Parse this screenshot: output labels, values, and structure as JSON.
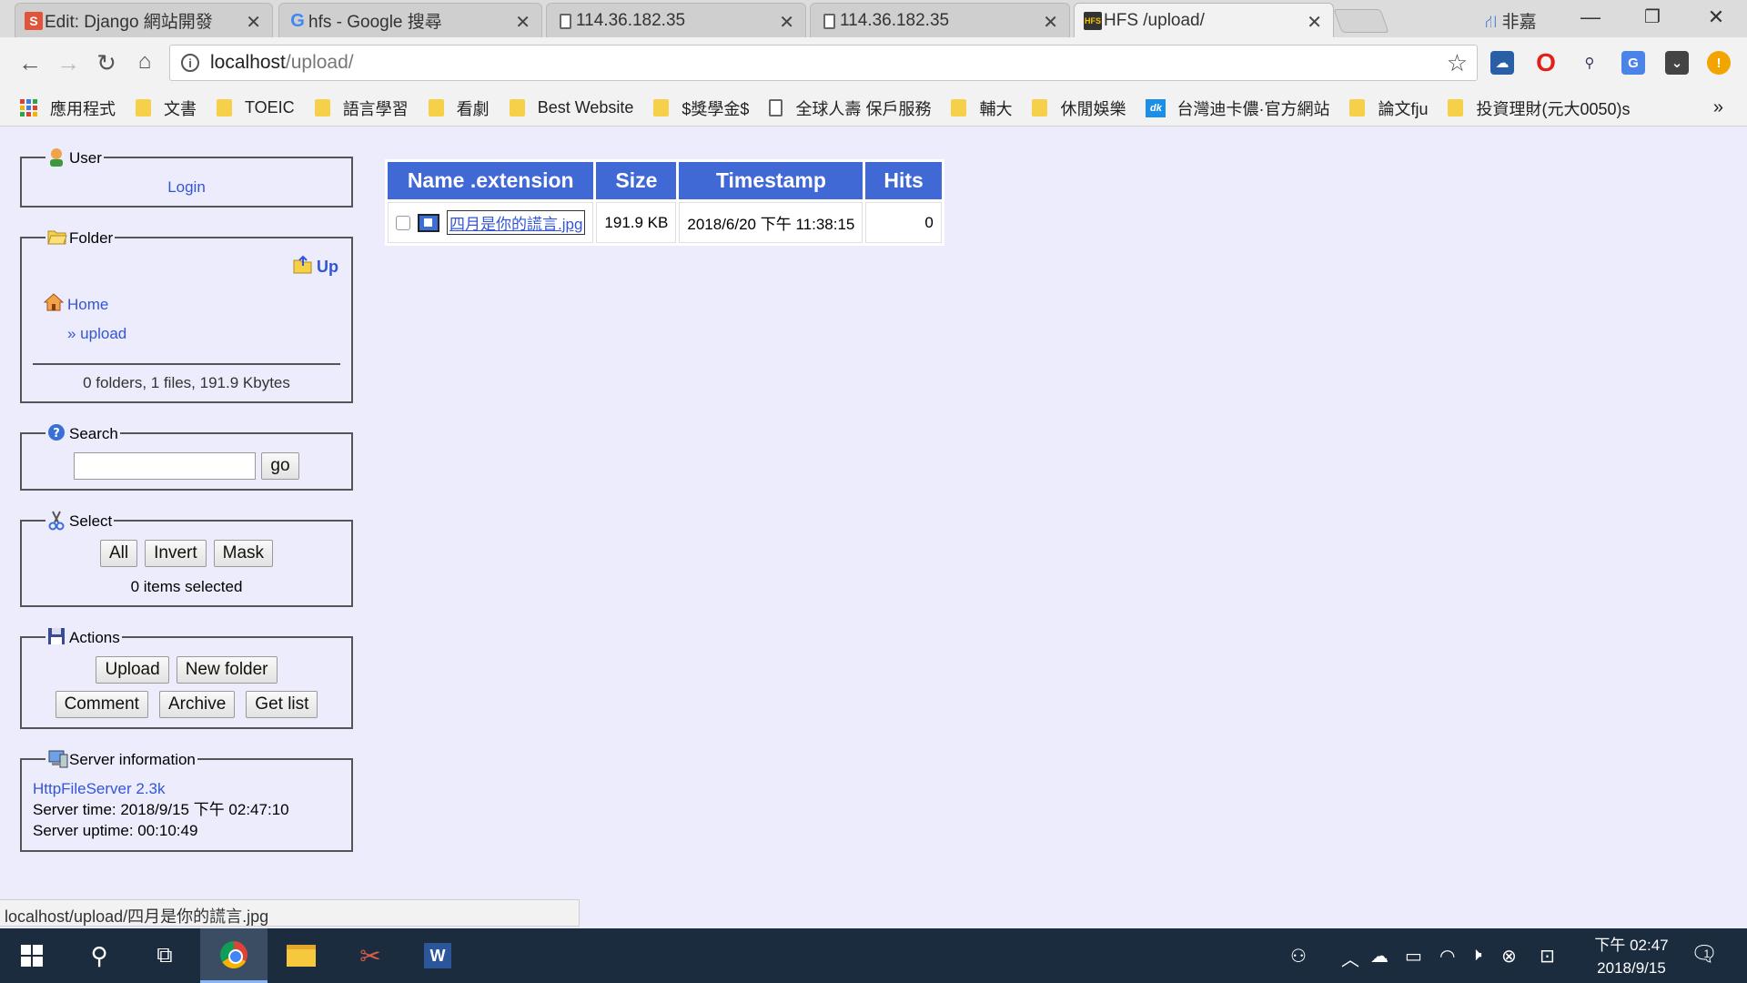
{
  "tabs": [
    {
      "favicon": "S",
      "favicon_color": "#e0543a",
      "title": "Edit: Django 網站開發",
      "left": 0
    },
    {
      "favicon": "G",
      "favicon_color": "#4285f4",
      "title": "hfs - Google 搜尋"
    },
    {
      "favicon": "page",
      "title": "114.36.182.35"
    },
    {
      "favicon": "page",
      "title": "114.36.182.35"
    },
    {
      "favicon": "HFS",
      "title": "HFS /upload/",
      "active": true
    }
  ],
  "window": {
    "profile": "非嘉"
  },
  "toolbar": {
    "url_host": "localhost",
    "url_path": "/upload/"
  },
  "bookmarks": [
    {
      "icon": "apps",
      "label": "應用程式"
    },
    {
      "icon": "folder",
      "label": "文書"
    },
    {
      "icon": "folder",
      "label": "TOEIC"
    },
    {
      "icon": "folder",
      "label": "語言學習"
    },
    {
      "icon": "folder",
      "label": "看劇"
    },
    {
      "icon": "folder",
      "label": "Best Website"
    },
    {
      "icon": "folder",
      "label": "$獎學金$"
    },
    {
      "icon": "page",
      "label": "全球人壽 保戶服務"
    },
    {
      "icon": "folder",
      "label": "輔大"
    },
    {
      "icon": "folder",
      "label": "休閒娛樂"
    },
    {
      "icon": "logo",
      "label": "台灣迪卡儂·官方網站"
    },
    {
      "icon": "folder",
      "label": "論文fju"
    },
    {
      "icon": "folder",
      "label": "投資理財(元大0050)s"
    }
  ],
  "bookmarks_more": "»",
  "panel": {
    "user": {
      "legend": "User",
      "login": "Login"
    },
    "folder": {
      "legend": "Folder",
      "up": "Up",
      "home": "Home",
      "crumb": "» upload",
      "info": "0 folders, 1 files, 191.9 Kbytes"
    },
    "search": {
      "legend": "Search",
      "go": "go",
      "value": ""
    },
    "select": {
      "legend": "Select",
      "all": "All",
      "invert": "Invert",
      "mask": "Mask",
      "count": "0 items selected"
    },
    "actions": {
      "legend": "Actions",
      "upload": "Upload",
      "new_folder": "New folder",
      "comment": "Comment",
      "archive": "Archive",
      "get_list": "Get list"
    },
    "server": {
      "legend": "Server information",
      "name": "HttpFileServer 2.3k",
      "time": "Server time: 2018/9/15 下午 02:47:10",
      "uptime": "Server uptime: 00:10:49"
    }
  },
  "table": {
    "headers": [
      "Name .extension",
      "Size",
      "Timestamp",
      "Hits"
    ],
    "rows": [
      {
        "name": "四月是你的謊言.jpg",
        "size": "191.9 KB",
        "timestamp": "2018/6/20 下午 11:38:15",
        "hits": "0"
      }
    ]
  },
  "status_url": "localhost/upload/四月是你的謊言.jpg",
  "taskbar": {
    "time": "下午 02:47",
    "date": "2018/9/15",
    "notifications": "1"
  }
}
